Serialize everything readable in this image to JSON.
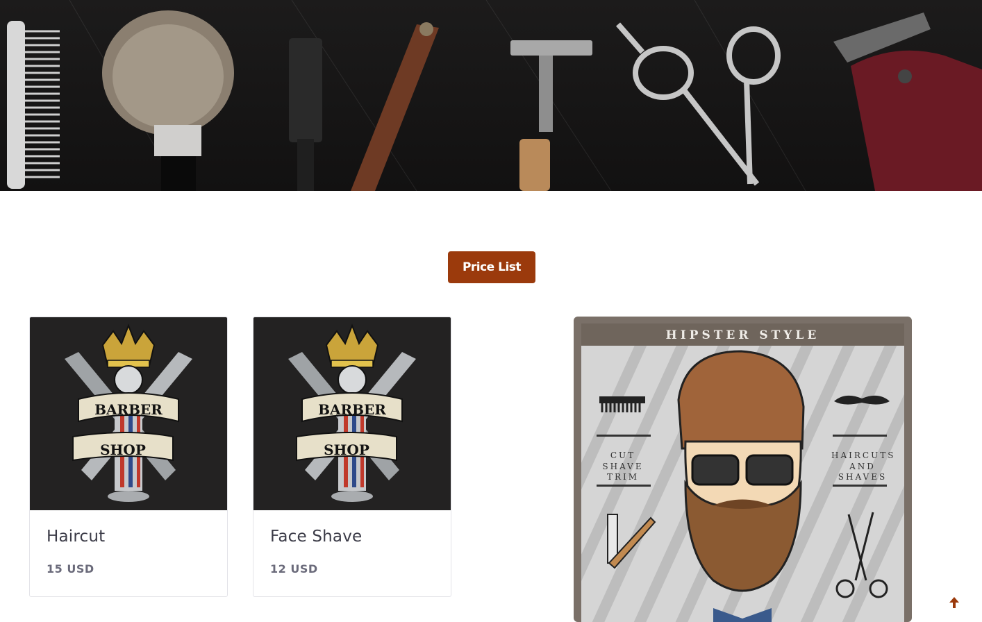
{
  "hero": {
    "tools": [
      "comb-icon",
      "shaving-brush-icon",
      "razor-handle-icon",
      "straight-razor-icon",
      "safety-razor-icon",
      "scissors-icon",
      "hair-clipper-icon"
    ]
  },
  "price_button": {
    "label": "Price List"
  },
  "services": [
    {
      "title": "Haircut",
      "price": "15 USD",
      "logo_text": [
        "BARBER",
        "SHOP"
      ]
    },
    {
      "title": "Face Shave",
      "price": "12 USD",
      "logo_text": [
        "BARBER",
        "SHOP"
      ]
    }
  ],
  "poster": {
    "title": "HIPSTER STYLE",
    "left_text": [
      "CUT",
      "SHAVE",
      "TRIM"
    ],
    "right_text": [
      "HAIRCUTS",
      "AND",
      "SHAVES"
    ]
  },
  "colors": {
    "accent": "#9b3a0c",
    "hero_bg": "#161515",
    "card_border": "#e3e3e8"
  }
}
